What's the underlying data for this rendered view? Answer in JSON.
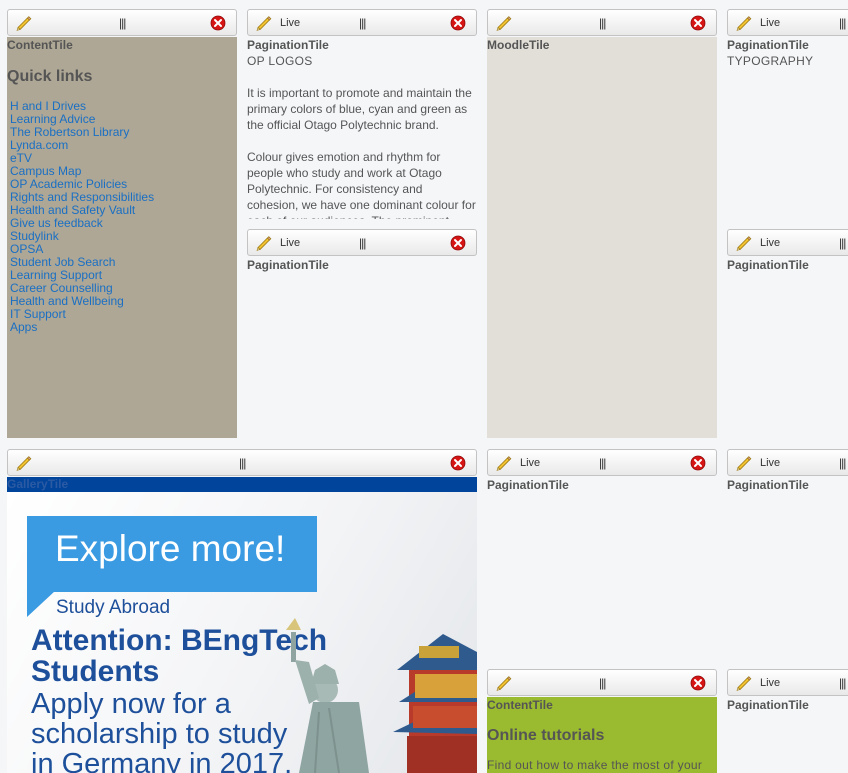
{
  "toolbar": {
    "live_label": "Live",
    "drag_glyph": "|||"
  },
  "icons": {
    "edit": "pencil-icon",
    "close": "close-icon",
    "drag": "drag-handle-icon"
  },
  "colors": {
    "content_tile_bg": "#aea795",
    "moodle_tile_bg": "#e2dfd9",
    "gallery_label_bg": "#00449b",
    "online_tile_bg": "#9aba2f",
    "link": "#1a6fc4",
    "close_red": "#cc1111",
    "explore_box": "#3a9be3",
    "attention_blue": "#1d4f9a"
  },
  "content_tile": {
    "name": "ContentTile",
    "title": "Quick links",
    "links": [
      "H and I Drives",
      "Learning Advice",
      "The Robertson Library",
      "Lynda.com",
      "eTV",
      "Campus Map",
      "OP Academic Policies",
      "Rights and Responsibilities",
      "Health and Safety Vault",
      "Give us feedback",
      "Studylink",
      "OPSA",
      "Student Job Search",
      "Learning Support",
      "Career Counselling",
      "Health and Wellbeing",
      "IT Support",
      "Apps"
    ]
  },
  "pagination_logos": {
    "name": "PaginationTile",
    "subtitle": "OP LOGOS",
    "paragraphs": [
      "It is important to promote and maintain the primary colors of blue, cyan and green as the official Otago Polytechnic brand.",
      "Colour gives emotion and rhythm for people who study and work at Otago Polytechnic. For consistency and cohesion, we have one dominant colour for each of our audiences. The prominent"
    ]
  },
  "moodle_tile": {
    "name": "MoodleTile"
  },
  "pagination_typography": {
    "name": "PaginationTile",
    "subtitle": "TYPOGRAPHY"
  },
  "pagination_empty": {
    "name": "PaginationTile"
  },
  "gallery_tile": {
    "name": "GalleryTile",
    "banner": {
      "explore": "Explore more!",
      "study_abroad": "Study Abroad",
      "attention_line1": "Attention: BEngTech",
      "attention_line2": "Students",
      "apply_line1": "Apply now for a",
      "apply_line2": "scholarship to study",
      "apply_line3": "in Germany in 2017."
    }
  },
  "online_tile": {
    "name": "ContentTile",
    "title": "Online tutorials",
    "text": "Find out how to make the most of your"
  }
}
